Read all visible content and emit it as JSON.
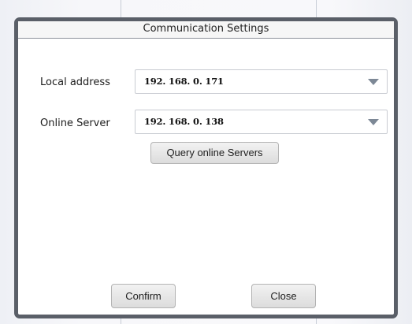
{
  "dialog": {
    "title": "Communication Settings"
  },
  "local_address": {
    "label": "Local address",
    "value": "192. 168. 0. 171"
  },
  "online_server": {
    "label": "Online Server",
    "value": "192. 168. 0. 138"
  },
  "buttons": {
    "query": "Query online Servers",
    "confirm": "Confirm",
    "close": "Close"
  },
  "icons": {
    "dropdown": "chevron-down-icon"
  }
}
